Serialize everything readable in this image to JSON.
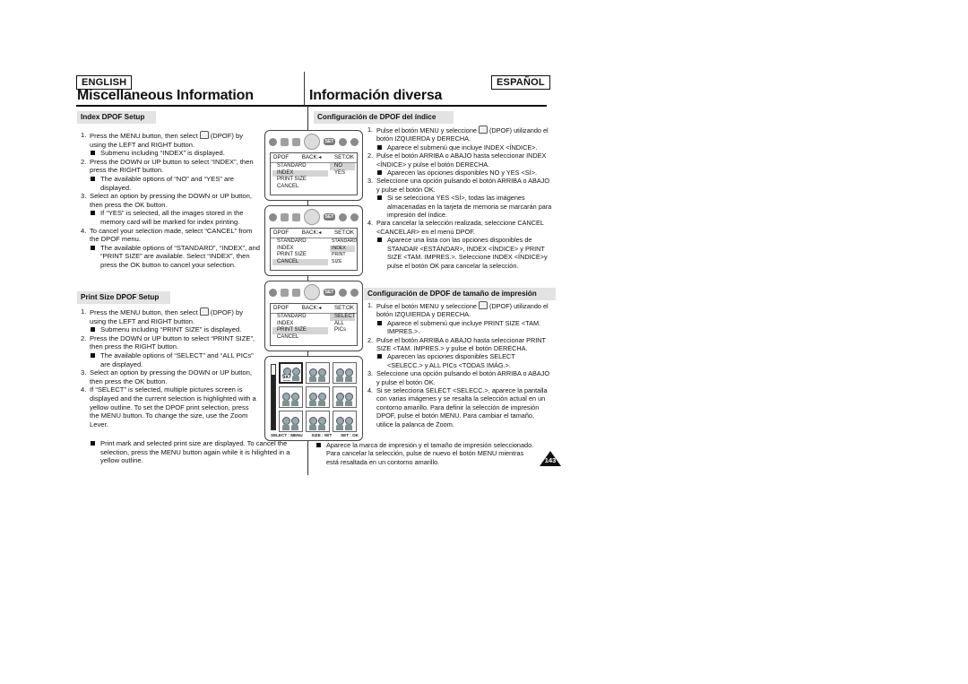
{
  "header": {
    "lang_left": "ENGLISH",
    "lang_right": "ESPAÑOL",
    "title_left": "Miscellaneous Information",
    "title_right": "Información diversa"
  },
  "english": {
    "index_section": {
      "heading": "Index DPOF Setup",
      "steps": [
        {
          "num": "1.",
          "text": "Press the MENU button, then select",
          "text_after_icon": "(DPOF) by using the LEFT and RIGHT button.",
          "note": "Submenu including “INDEX” is displayed."
        },
        {
          "num": "2.",
          "text": "Press the DOWN or UP button to select “INDEX”, then press the RIGHT button.",
          "note": "The available options of “NO” and “YES” are displayed."
        },
        {
          "num": "3.",
          "text": "Select an option by pressing the DOWN or UP button, then press the OK button.",
          "note": "If “YES” is selected, all the images stored in the memory card will be marked for index printing."
        },
        {
          "num": "4.",
          "text": "To cancel your selection made, select “CANCEL” from the DPOF menu.",
          "note": "The available options of “STANDARD”, “INDEX”, and “PRINT SIZE” are available. Select “INDEX”, then press the OK button to cancel your selection."
        }
      ]
    },
    "print_size_section": {
      "heading": "Print Size DPOF Setup",
      "steps": [
        {
          "num": "1.",
          "text": "Press the MENU button, then select",
          "text_after_icon": "(DPOF) by using the LEFT and RIGHT button.",
          "note": "Submenu including “PRINT SIZE” is displayed."
        },
        {
          "num": "2.",
          "text": "Press the DOWN or UP button to select “PRINT SIZE”, then press the RIGHT button.",
          "note": "The available options of “SELECT” and “ALL PICs” are displayed."
        },
        {
          "num": "3.",
          "text": "Select an option by pressing the DOWN or UP button, then press the OK button.",
          "note": ""
        },
        {
          "num": "4.",
          "text": "If “SELECT” is selected, multiple pictures screen is displayed and the current selection is highlighted with a yellow outline. To set the DPOF print selection, press the MENU button. To change the size, use the Zoom Lever.",
          "note": "Print mark and selected print size are displayed. To cancel the selection, press the MENU button again while it is hilighted in a yellow outline."
        }
      ]
    }
  },
  "spanish": {
    "index_section": {
      "heading": "Configuración de DPOF del índice",
      "steps": [
        {
          "num": "1.",
          "text": "Pulse el botón MENU y seleccione",
          "text_after_icon": "(DPOF) utilizando el botón IZQUIERDA y DERECHA.",
          "note": "Aparece el submenú que incluye INDEX <ÍNDICE>."
        },
        {
          "num": "2.",
          "text": "Pulse el botón ARRIBA o ABAJO hasta seleccionar INDEX <ÍNDICE> y pulse el botón DERECHA.",
          "note": "Aparecen las opciones disponibles NO y YES <SÍ>."
        },
        {
          "num": "3.",
          "text": "Seleccione una opción pulsando el botón ARRIBA o ABAJO y pulse el botón OK.",
          "note": "Si se selecciona YES <SÍ>, todas las imágenes almacenadas en la tarjeta de memoria se marcarán para impresión del índice."
        },
        {
          "num": "4.",
          "text": "Para cancelar la selección realizada, seleccione CANCEL <CANCELAR> en el menú DPOF.",
          "note": "Aparece una lista con las opciones disponibles de STANDAR <ESTÁNDAR>, INDEX <ÍNDICE> y PRINT SIZE <TAM. IMPRES.>. Seleccione INDEX <ÍNDICE>y pulse el botón OK para cancelar la selección."
        }
      ]
    },
    "print_size_section": {
      "heading": "Configuración de DPOF de tamaño de impresión",
      "steps": [
        {
          "num": "1.",
          "text": "Pulse el botón MENU y seleccione",
          "text_after_icon": "(DPOF) utilizando el botón IZQUIERDA y DERECHA.",
          "note": "Aparece el submenú que incluye PRINT SIZE <TAM. IMPRES.>."
        },
        {
          "num": "2.",
          "text": "Pulse el botón ARRIBA o ABAJO hasta seleccionar PRINT SIZE <TAM. IMPRES.> y pulse el botón DERECHA.",
          "note": "Aparecen las opciones disponibles SELECT <SELECC.> y ALL PICs <TODAS IMÁG.>."
        },
        {
          "num": "3.",
          "text": "Seleccione una opción pulsando el botón ARRIBA o ABAJO y pulse el botón OK.",
          "note": ""
        },
        {
          "num": "4.",
          "text": "Si se selecciona SELECT <SELECC.>, aparece la pantalla con varias imágenes y se resalta la selección actual en un contorno amarillo. Para definir la selección de impresión DPOF, pulse el botón MENU. Para cambiar el tamaño, utilice la palanca de Zoom.",
          "note": "Aparece la marca de impresión y el tamaño de impresión seleccionado. Para cancelar la selección, pulse de nuevo el botón MENU mientras está resaltada en un contorno amarillo."
        }
      ]
    }
  },
  "screens": {
    "menu_header": {
      "title": "DPOF",
      "back": "BACK:◂",
      "set": "SET:OK"
    },
    "set_label": "SET",
    "screen1": {
      "left": [
        "STANDARD",
        "INDEX",
        "PRINT SIZE",
        "CANCEL"
      ],
      "left_selected": 1,
      "right": [
        "NO",
        "YES"
      ],
      "right_selected": 0
    },
    "screen2": {
      "left": [
        "STANDARD",
        "INDEX",
        "PRINT SIZE",
        "CANCEL"
      ],
      "left_selected": 3,
      "right": [
        "STANDARD",
        "INDEX",
        "PRINT SIZE"
      ],
      "right_selected": 1
    },
    "screen3": {
      "left": [
        "STANDARD",
        "INDEX",
        "PRINT SIZE",
        "CANCEL"
      ],
      "left_selected": 2,
      "right": [
        "SELECT",
        "ALL PICs"
      ],
      "right_selected": 0
    },
    "screen4": {
      "print_size_mark": "5x7",
      "footer_select": "SELECT : MENU",
      "footer_size": "SIZE : W/T",
      "footer_set": "SET : OK",
      "zoom_level": 0.85
    }
  },
  "page_number": "143"
}
